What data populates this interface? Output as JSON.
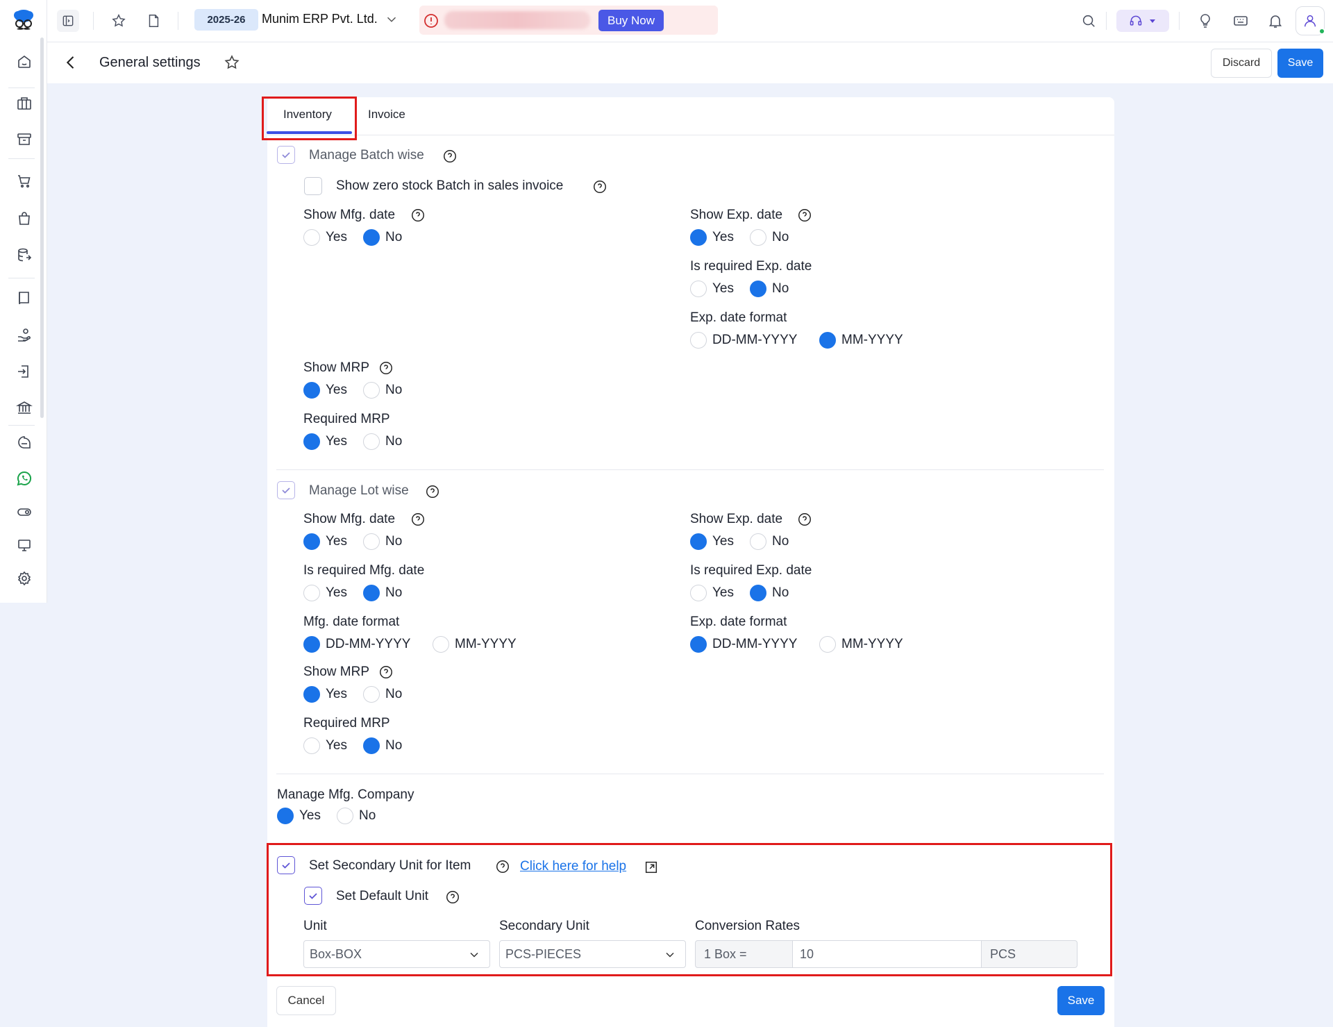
{
  "header": {
    "financial_year": "2025-26",
    "company_name": "Munim ERP Pvt. Ltd.",
    "buy_now_label": "Buy Now"
  },
  "subheader": {
    "title": "General settings",
    "discard_label": "Discard",
    "save_label": "Save"
  },
  "tabs": [
    {
      "label": "Inventory",
      "active": true
    },
    {
      "label": "Invoice",
      "active": false
    }
  ],
  "batch": {
    "manage_label": "Manage Batch wise",
    "manage_checked": true,
    "zero_stock_label": "Show zero stock Batch in sales invoice",
    "zero_stock_checked": false,
    "show_mfg_label": "Show Mfg. date",
    "show_mfg_value": "No",
    "show_exp_label": "Show Exp. date",
    "show_exp_value": "Yes",
    "req_exp_label": "Is required Exp. date",
    "req_exp_value": "No",
    "exp_format_label": "Exp. date format",
    "exp_format_value": "MM-YYYY",
    "show_mrp_label": "Show MRP",
    "show_mrp_value": "Yes",
    "req_mrp_label": "Required MRP",
    "req_mrp_value": "Yes"
  },
  "lot": {
    "manage_label": "Manage Lot wise",
    "manage_checked": true,
    "show_mfg_label": "Show Mfg. date",
    "show_mfg_value": "Yes",
    "show_exp_label": "Show Exp. date",
    "show_exp_value": "Yes",
    "req_mfg_label": "Is required Mfg. date",
    "req_mfg_value": "No",
    "req_exp_label": "Is required Exp. date",
    "req_exp_value": "No",
    "mfg_format_label": "Mfg. date format",
    "mfg_format_value": "DD-MM-YYYY",
    "exp_format_label": "Exp. date format",
    "exp_format_value": "DD-MM-YYYY",
    "show_mrp_label": "Show MRP",
    "show_mrp_value": "Yes",
    "req_mrp_label": "Required MRP",
    "req_mrp_value": "No"
  },
  "mfg_company": {
    "label": "Manage Mfg. Company",
    "value": "Yes"
  },
  "options": {
    "yes": "Yes",
    "no": "No",
    "dd_mm_yyyy": "DD-MM-YYYY",
    "mm_yyyy": "MM-YYYY"
  },
  "secondary": {
    "label": "Set Secondary Unit for Item",
    "checked": true,
    "help_link": "Click here for help",
    "default_label": "Set Default Unit",
    "default_checked": true,
    "unit_label": "Unit",
    "unit_value": "Box-BOX",
    "secondary_label": "Secondary Unit",
    "secondary_value": "PCS-PIECES",
    "conversion_label": "Conversion Rates",
    "conversion_prefix": "1 Box =",
    "conversion_value": "10",
    "conversion_suffix": "PCS"
  },
  "footer": {
    "cancel_label": "Cancel",
    "save_label": "Save"
  },
  "colors": {
    "primary": "#1a73e8",
    "highlight": "#e01b1b",
    "buy_now": "#4a58e6"
  }
}
